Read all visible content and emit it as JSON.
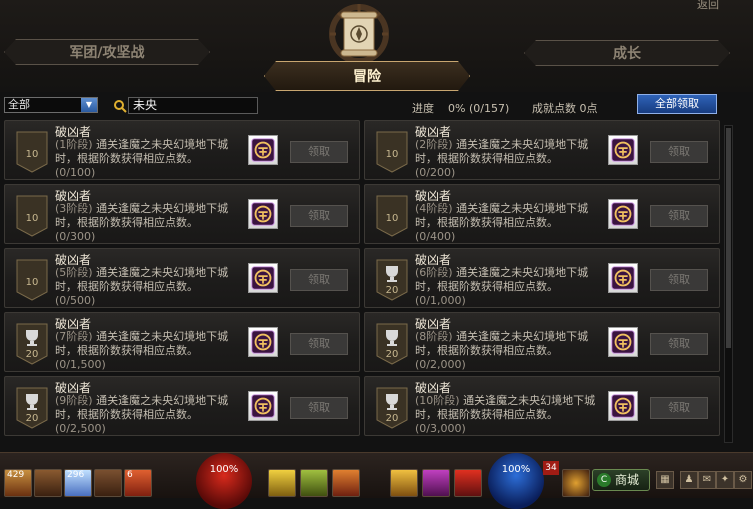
{
  "header": {
    "top_link": "返回",
    "tabs": {
      "left": "军团/攻坚战",
      "active": "冒险",
      "right": "成长"
    }
  },
  "filter": {
    "category": "全部",
    "search_value": "未央",
    "progress_label": "进度",
    "progress_value": "0%",
    "progress_count": "(0/157)",
    "points_label": "成就点数",
    "points_value": "0点",
    "claim_all_label": "全部领取"
  },
  "achievements": [
    {
      "title": "破凶者",
      "stage": "(1阶段)",
      "desc": "通关逢魔之未央幻境地下城时，根据阶数获得相应点数。",
      "progress": "(0/100)",
      "badge": "10",
      "badge_type": "shield",
      "button": "领取"
    },
    {
      "title": "破凶者",
      "stage": "(2阶段)",
      "desc": "通关逢魔之未央幻境地下城时，根据阶数获得相应点数。",
      "progress": "(0/200)",
      "badge": "10",
      "badge_type": "shield",
      "button": "领取"
    },
    {
      "title": "破凶者",
      "stage": "(3阶段)",
      "desc": "通关逢魔之未央幻境地下城时，根据阶数获得相应点数。",
      "progress": "(0/300)",
      "badge": "10",
      "badge_type": "shield",
      "button": "领取"
    },
    {
      "title": "破凶者",
      "stage": "(4阶段)",
      "desc": "通关逢魔之未央幻境地下城时，根据阶数获得相应点数。",
      "progress": "(0/400)",
      "badge": "10",
      "badge_type": "shield",
      "button": "领取"
    },
    {
      "title": "破凶者",
      "stage": "(5阶段)",
      "desc": "通关逢魔之未央幻境地下城时，根据阶数获得相应点数。",
      "progress": "(0/500)",
      "badge": "10",
      "badge_type": "shield",
      "button": "领取"
    },
    {
      "title": "破凶者",
      "stage": "(6阶段)",
      "desc": "通关逢魔之未央幻境地下城时，根据阶数获得相应点数。",
      "progress": "(0/1,000)",
      "badge": "20",
      "badge_type": "trophy",
      "button": "领取"
    },
    {
      "title": "破凶者",
      "stage": "(7阶段)",
      "desc": "通关逢魔之未央幻境地下城时，根据阶数获得相应点数。",
      "progress": "(0/1,500)",
      "badge": "20",
      "badge_type": "trophy",
      "button": "领取"
    },
    {
      "title": "破凶者",
      "stage": "(8阶段)",
      "desc": "通关逢魔之未央幻境地下城时，根据阶数获得相应点数。",
      "progress": "(0/2,000)",
      "badge": "20",
      "badge_type": "trophy",
      "button": "领取"
    },
    {
      "title": "破凶者",
      "stage": "(9阶段)",
      "desc": "通关逢魔之未央幻境地下城时，根据阶数获得相应点数。",
      "progress": "(0/2,500)",
      "badge": "20",
      "badge_type": "trophy",
      "button": "领取"
    },
    {
      "title": "破凶者",
      "stage": "(10阶段)",
      "desc": "通关逢魔之未央幻境地下城时，根据阶数获得相应点数。",
      "progress": "(0/3,000)",
      "badge": "20",
      "badge_type": "trophy",
      "button": "领取"
    }
  ],
  "hud": {
    "hp": "100%",
    "mp": "100%",
    "level": "34",
    "shop_label": "商城",
    "slot_counts": [
      "429",
      "296",
      "6"
    ],
    "icons": [
      "hp-orb-icon",
      "mp-orb-icon",
      "skill-icon",
      "shop-icon",
      "menu-icon"
    ]
  }
}
